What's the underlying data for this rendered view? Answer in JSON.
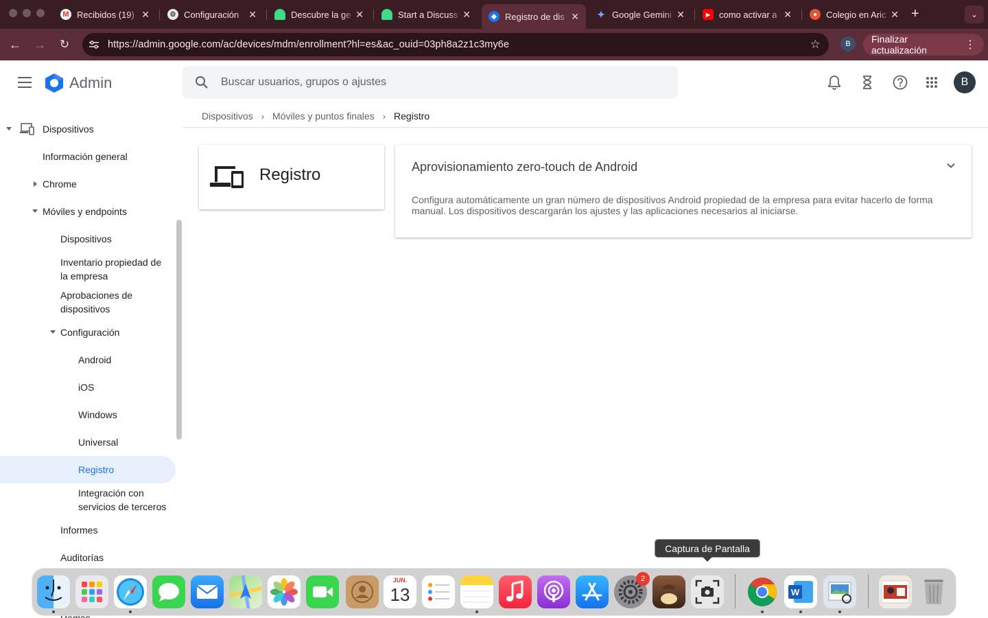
{
  "browser": {
    "tabs": [
      {
        "label": "Recibidos (19)",
        "icon": "gmail-icon"
      },
      {
        "label": "Configuración",
        "icon": "settings-icon"
      },
      {
        "label": "Descubre la ge",
        "icon": "android-icon"
      },
      {
        "label": "Start a Discuss",
        "icon": "android-icon"
      },
      {
        "label": "Registro de dis",
        "icon": "admin-icon"
      },
      {
        "label": "Google Gemini",
        "icon": "gemini-icon"
      },
      {
        "label": "como activar a",
        "icon": "youtube-icon"
      },
      {
        "label": "Colegio en Aric",
        "icon": "school-icon"
      }
    ],
    "url": "https://admin.google.com/ac/devices/mdm/enrollment?hl=es&ac_ouid=03ph8a2z1c3my6e",
    "profile_initial": "B",
    "update_label": "Finalizar actualización"
  },
  "header": {
    "app_name": "Admin",
    "search_placeholder": "Buscar usuarios, grupos o ajustes",
    "avatar_initial": "B"
  },
  "sidebar": {
    "dispositivos": "Dispositivos",
    "info_general": "Información general",
    "chrome": "Chrome",
    "moviles": "Móviles y endpoints",
    "moviles_dispositivos": "Dispositivos",
    "inventario_1": "Inventario propiedad de",
    "inventario_2": "la empresa",
    "aprobaciones_1": "Aprobaciones de",
    "aprobaciones_2": "dispositivos",
    "configuracion": "Configuración",
    "android": "Android",
    "ios": "iOS",
    "windows": "Windows",
    "universal": "Universal",
    "registro": "Registro",
    "integracion_1": "Integración con",
    "integracion_2": "servicios de terceros",
    "informes": "Informes",
    "auditorias": "Auditorías",
    "reglas": "Reglas"
  },
  "breadcrumb": [
    "Dispositivos",
    "Móviles y puntos finales",
    "Registro"
  ],
  "main": {
    "page_title": "Registro",
    "card_title": "Aprovisionamiento zero-touch de Android",
    "card_description": "Configura automáticamente un gran número de dispositivos Android propiedad de la empresa para evitar hacerlo de forma manual. Los dispositivos descargarán los ajustes y las aplicaciones necesarios al iniciarse."
  },
  "dock": {
    "tooltip": "Captura de Pantalla",
    "calendar_month": "JUN.",
    "calendar_day": "13",
    "settings_badge": "2",
    "apps": [
      "Finder",
      "Launchpad",
      "Safari",
      "Mensajes",
      "Mail",
      "Mapas",
      "Fotos",
      "FaceTime",
      "Contactos",
      "Calendario",
      "Recordatorios",
      "Notas",
      "Música",
      "Podcasts",
      "App Store",
      "Ajustes del Sistema",
      "Juego",
      "Captura de Pantalla",
      "Google Chrome",
      "Microsoft Word",
      "Vista Previa",
      "Imagen",
      "Papelera"
    ]
  },
  "colors": {
    "tab_bar": "#3a1d24",
    "toolbar": "#5b2d38",
    "admin_blue": "#1a73e8",
    "active_nav": "#e8f0fe"
  }
}
